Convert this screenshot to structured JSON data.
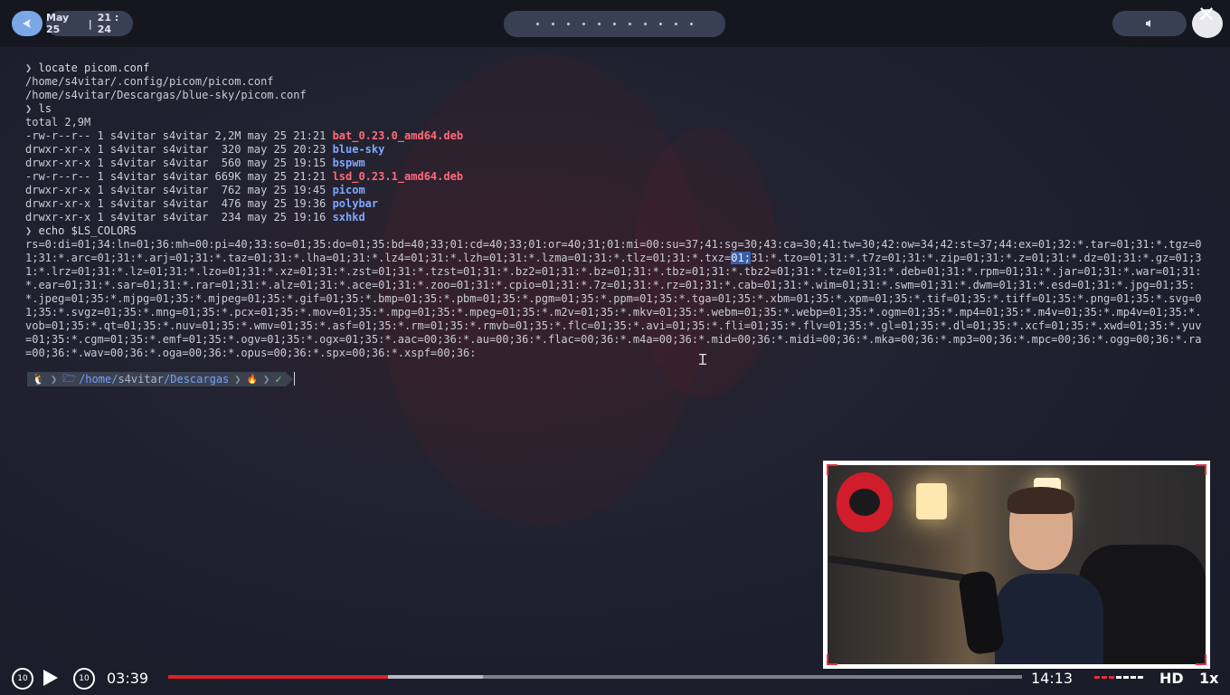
{
  "topbar": {
    "date": "May 25",
    "time": "21 : 24",
    "launcher_icon": "launcher-icon",
    "workspaces_count": 11,
    "volume_icon": "speaker-icon",
    "close_icon": "close-icon"
  },
  "terminal": {
    "lines": [
      {
        "type": "cmd",
        "text": "locate picom.conf"
      },
      {
        "type": "out",
        "text": "/home/s4vitar/.config/picom/picom.conf"
      },
      {
        "type": "out",
        "text": "/home/s4vitar/Descargas/blue-sky/picom.conf"
      },
      {
        "type": "cmd",
        "text": "ls"
      },
      {
        "type": "out",
        "text": "total 2,9M"
      },
      {
        "type": "ls",
        "perm": "-rw-r--r-- 1 s4vitar s4vitar 2,2M may 25 21:21 ",
        "name": "bat_0.23.0_amd64.deb",
        "color": "red"
      },
      {
        "type": "ls",
        "perm": "drwxr-xr-x 1 s4vitar s4vitar  320 may 25 20:23 ",
        "name": "blue-sky",
        "color": "blue"
      },
      {
        "type": "ls",
        "perm": "drwxr-xr-x 1 s4vitar s4vitar  560 may 25 19:15 ",
        "name": "bspwm",
        "color": "blue"
      },
      {
        "type": "ls",
        "perm": "-rw-r--r-- 1 s4vitar s4vitar 669K may 25 21:21 ",
        "name": "lsd_0.23.1_amd64.deb",
        "color": "red"
      },
      {
        "type": "ls",
        "perm": "drwxr-xr-x 1 s4vitar s4vitar  762 may 25 19:45 ",
        "name": "picom",
        "color": "blue"
      },
      {
        "type": "ls",
        "perm": "drwxr-xr-x 1 s4vitar s4vitar  476 may 25 19:36 ",
        "name": "polybar",
        "color": "blue"
      },
      {
        "type": "ls",
        "perm": "drwxr-xr-x 1 s4vitar s4vitar  234 may 25 19:16 ",
        "name": "sxhkd",
        "color": "blue"
      },
      {
        "type": "cmd",
        "text": "echo $LS_COLORS"
      }
    ],
    "prompt_arrow": "❯",
    "ls_colors_before": "rs=0:di=01;34:ln=01;36:mh=00:pi=40;33:so=01;35:do=01;35:bd=40;33;01:cd=40;33;01:or=40;31;01:mi=00:su=37;41:sg=30;43:ca=30;41:tw=30;42:ow=34;42:st=37;44:ex=01;32:*.tar=01;31:*.tgz=01;31:*.arc=01;31:*.arj=01;31:*.taz=01;31:*.lha=01;31:*.lz4=01;31:*.lzh=01;31:*.lzma=01;31:*.tlz=01;31:*.txz=",
    "ls_colors_selected": "01;",
    "ls_colors_after": "31:*.tzo=01;31:*.t7z=01;31:*.zip=01;31:*.z=01;31:*.dz=01;31:*.gz=01;31:*.lrz=01;31:*.lz=01;31:*.lzo=01;31:*.xz=01;31:*.zst=01;31:*.tzst=01;31:*.bz2=01;31:*.bz=01;31:*.tbz=01;31:*.tbz2=01;31:*.tz=01;31:*.deb=01;31:*.rpm=01;31:*.jar=01;31:*.war=01;31:*.ear=01;31:*.sar=01;31:*.rar=01;31:*.alz=01;31:*.ace=01;31:*.zoo=01;31:*.cpio=01;31:*.7z=01;31:*.rz=01;31:*.cab=01;31:*.wim=01;31:*.swm=01;31:*.dwm=01;31:*.esd=01;31:*.jpg=01;35:*.jpeg=01;35:*.mjpg=01;35:*.mjpeg=01;35:*.gif=01;35:*.bmp=01;35:*.pbm=01;35:*.pgm=01;35:*.ppm=01;35:*.tga=01;35:*.xbm=01;35:*.xpm=01;35:*.tif=01;35:*.tiff=01;35:*.png=01;35:*.svg=01;35:*.svgz=01;35:*.mng=01;35:*.pcx=01;35:*.mov=01;35:*.mpg=01;35:*.mpeg=01;35:*.m2v=01;35:*.mkv=01;35:*.webm=01;35:*.webp=01;35:*.ogm=01;35:*.mp4=01;35:*.m4v=01;35:*.mp4v=01;35:*.vob=01;35:*.qt=01;35:*.nuv=01;35:*.wmv=01;35:*.asf=01;35:*.rm=01;35:*.rmvb=01;35:*.flc=01;35:*.avi=01;35:*.fli=01;35:*.flv=01;35:*.gl=01;35:*.dl=01;35:*.xcf=01;35:*.xwd=01;35:*.yuv=01;35:*.cgm=01;35:*.emf=01;35:*.ogv=01;35:*.ogx=01;35:*.aac=00;36:*.au=00;36:*.flac=00;36:*.m4a=00;36:*.mid=00;36:*.midi=00;36:*.mka=00;36:*.mp3=00;36:*.mpc=00;36:*.ogg=00;36:*.ra=00;36:*.wav=00;36:*.oga=00;36:*.opus=00;36:*.spx=00;36:*.xspf=00;36:",
    "powerline": {
      "os_icon": "🐧",
      "path_prefix": "/home/",
      "path_user": "s4vitar",
      "path_suffix": "/Descargas",
      "git_icon": "🔥",
      "status_icon": "✓"
    }
  },
  "player": {
    "rewind_label": "10",
    "forward_label": "10",
    "current_time": "03:39",
    "duration": "14:13",
    "quality": "HD",
    "speed": "1x",
    "played_fraction": 0.257,
    "buffered_fraction": 0.369
  },
  "colors": {
    "accent_red": "#e01e2c",
    "dir_blue": "#7fa8ff",
    "archive_red": "#ff6b7a"
  }
}
